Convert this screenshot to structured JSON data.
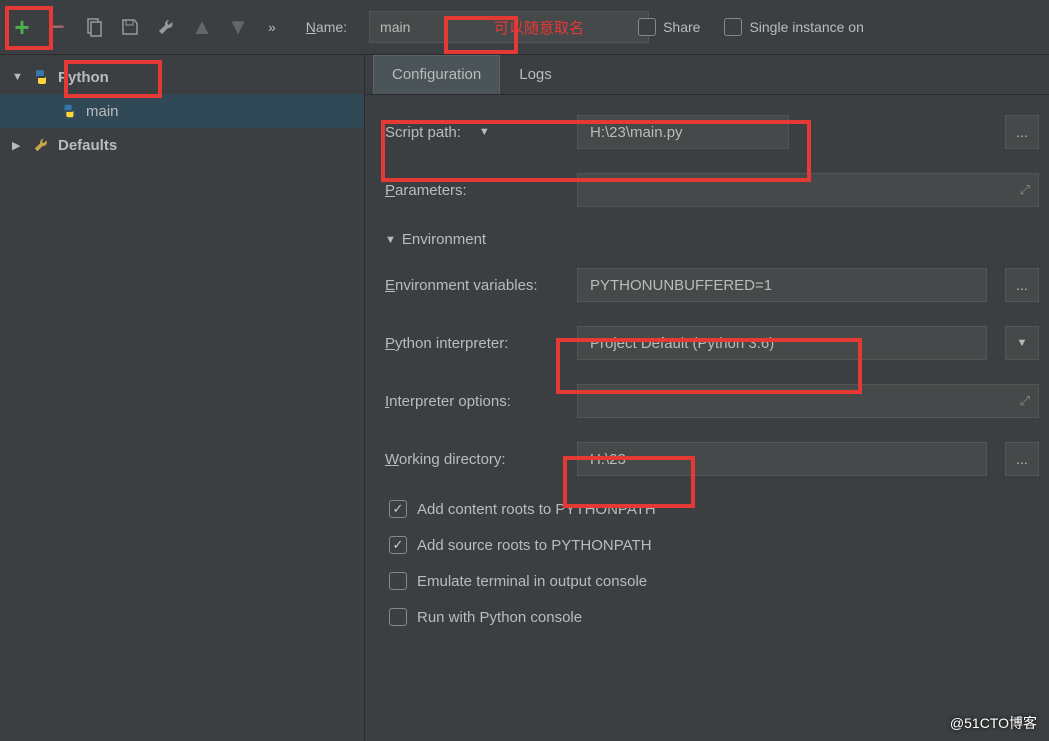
{
  "toolbar": {
    "name_label_prefix": "N",
    "name_label_rest": "ame:",
    "name_value": "main",
    "annotation": "可以随意取名",
    "share_label_prefix": "S",
    "share_label_rest": "hare",
    "single_instance": "Single instance on"
  },
  "sidebar": {
    "python_group": "Python",
    "item_main": "main",
    "defaults": "Defaults"
  },
  "tabs": {
    "configuration": "Configuration",
    "logs": "Logs"
  },
  "form": {
    "script_path_label": "Script path:",
    "script_path_value": "H:\\23\\main.py",
    "parameters_label_prefix": "P",
    "parameters_label_rest": "arameters:",
    "environment_header": "Environment",
    "env_vars_label_prefix": "E",
    "env_vars_label_rest": "nvironment variables:",
    "env_vars_value": "PYTHONUNBUFFERED=1",
    "interpreter_label_prefix": "P",
    "interpreter_label_rest": "ython interpreter:",
    "interpreter_value": "Project Default (Python 3.6)",
    "interp_options_label_prefix": "I",
    "interp_options_label_rest": "nterpreter options:",
    "workdir_label_prefix": "W",
    "workdir_label_rest": "orking directory:",
    "workdir_value": "H:\\23",
    "add_content_roots": "Add content roots to PYTHONPATH",
    "add_source_roots": "Add source roots to PYTHONPATH",
    "emulate_terminal": "Emulate terminal in output console",
    "run_console": "Run with Python console"
  },
  "watermark": "@51CTO博客",
  "icons": {
    "ellipsis": "...",
    "dropdown": "▼"
  }
}
